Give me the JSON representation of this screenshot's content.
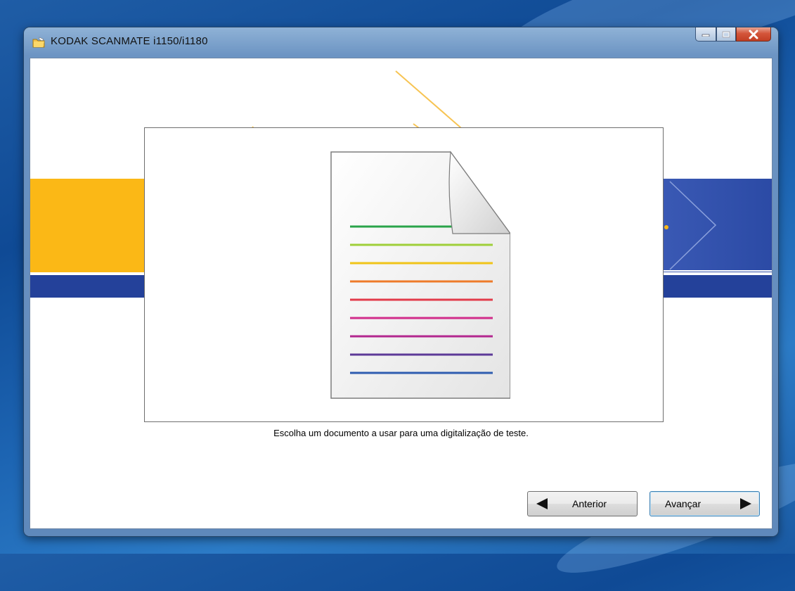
{
  "window": {
    "title": "KODAK SCANMATE i1150/i1180"
  },
  "content": {
    "instruction": "Escolha um documento a usar para uma digitalização de teste.",
    "document_line_colors": [
      "#2aa44a",
      "#9fcf3a",
      "#f0c419",
      "#ee7b2a",
      "#e23b4a",
      "#d12c8a",
      "#b3278f",
      "#5d3a98",
      "#2f5db0"
    ]
  },
  "buttons": {
    "previous_label": "Anterior",
    "next_label": "Avançar"
  },
  "colors": {
    "brand_yellow": "#fbb816",
    "brand_blue": "#24419a",
    "close_red": "#c23f24"
  }
}
